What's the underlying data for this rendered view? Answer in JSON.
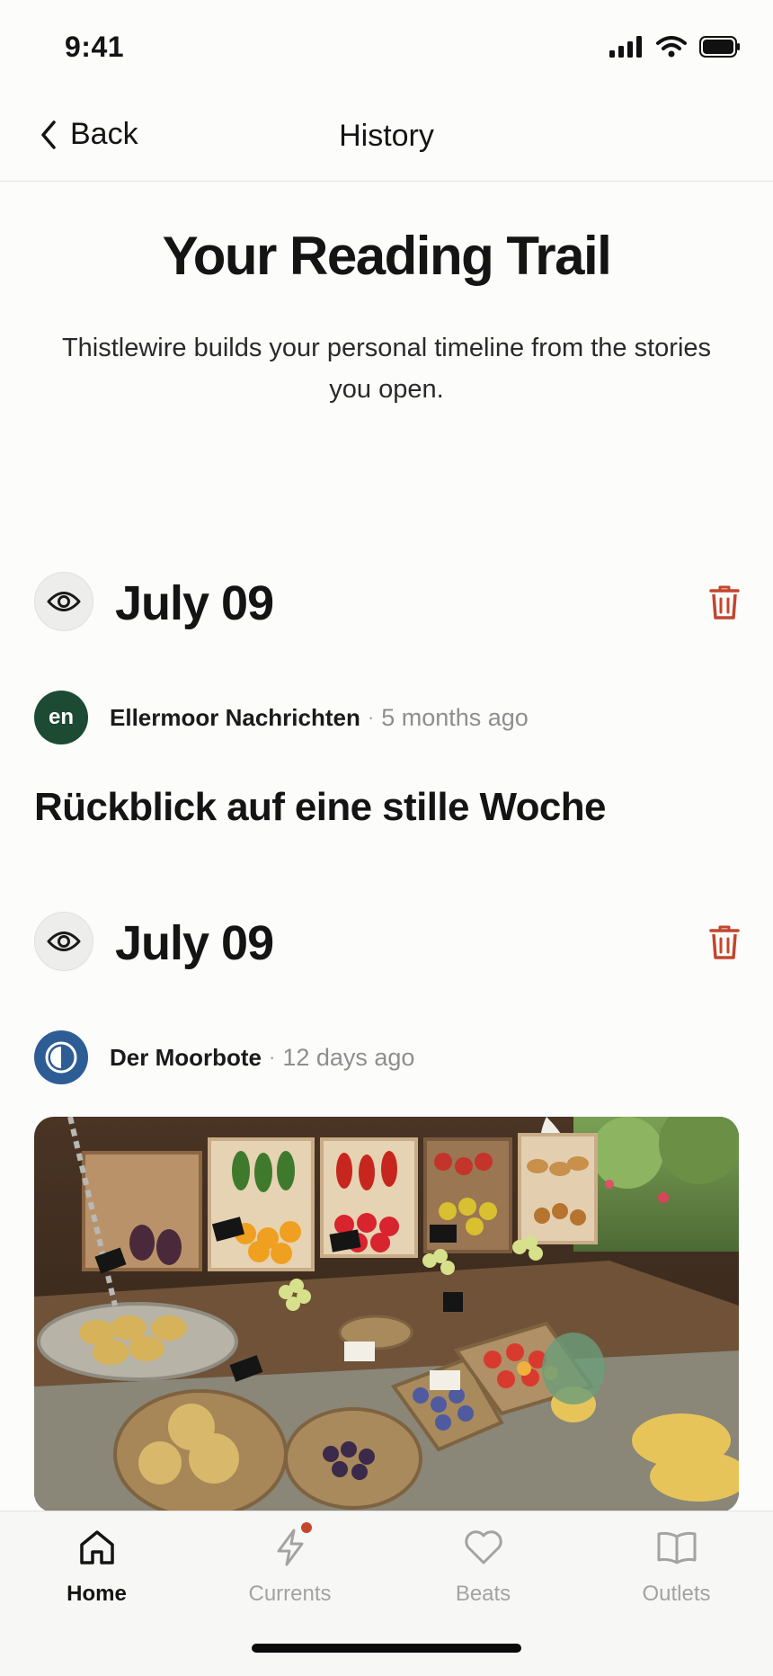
{
  "status_bar": {
    "time": "9:41"
  },
  "nav": {
    "back_label": "Back",
    "title": "History"
  },
  "hero": {
    "title": "Your Reading Trail",
    "subtitle": "Thistlewire builds your personal timeline from the stories you open."
  },
  "entries": [
    {
      "date": "July 09",
      "source": {
        "avatar_text": "en",
        "name": "Ellermoor Nachrichten",
        "separator": "·",
        "time": "5 months ago",
        "avatar_color": "#1c4a33"
      },
      "headline": "Rückblick auf eine stille Woche"
    },
    {
      "date": "July 09",
      "source": {
        "avatar_text": "",
        "name": "Der Moorbote",
        "separator": "·",
        "time": "12 days ago",
        "avatar_color": "#2e5d95"
      },
      "image_icon": "market-produce-photo"
    }
  ],
  "tabs": [
    {
      "label": "Home",
      "icon": "home-icon",
      "active": true
    },
    {
      "label": "Currents",
      "icon": "lightning-icon",
      "badge": true
    },
    {
      "label": "Beats",
      "icon": "heart-icon"
    },
    {
      "label": "Outlets",
      "icon": "book-icon"
    }
  ],
  "colors": {
    "accent_red": "#c4452c",
    "text": "#141414",
    "muted": "#8e8e8e",
    "background": "#fcfcfb"
  }
}
